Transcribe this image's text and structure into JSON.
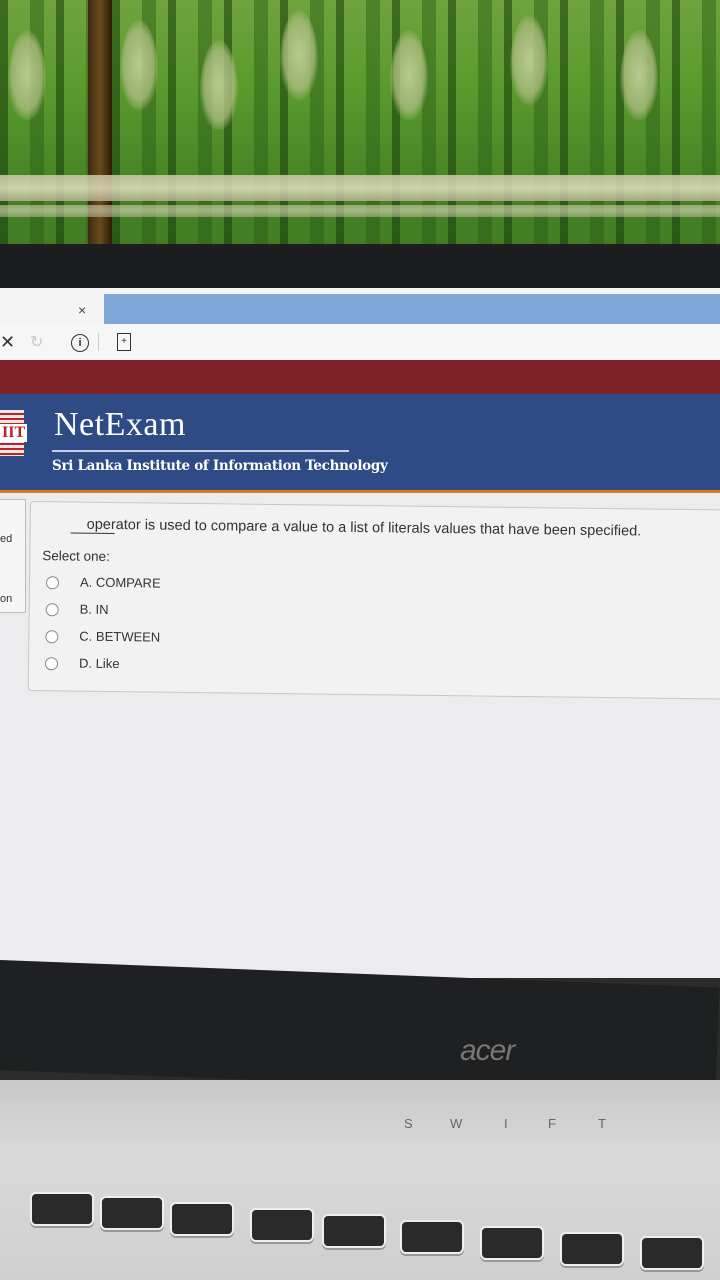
{
  "browser": {
    "tab_close_glyph": "×",
    "nav_close_glyph": "✕",
    "reload_glyph": "↻",
    "info_glyph": "i",
    "page_glyph": "+"
  },
  "header": {
    "logo_text": "IIT",
    "brand": "NetExam",
    "institute": "Sri Lanka Institute of Information Technology"
  },
  "sidebar": {
    "stub_top": "ed",
    "stub_bottom": "on"
  },
  "question": {
    "text": "operator is used to compare a value to a list of literals values that have been specified.",
    "prompt": "Select one:",
    "options": [
      {
        "label": "A. COMPARE"
      },
      {
        "label": "B. IN"
      },
      {
        "label": "C. BETWEEN"
      },
      {
        "label": "D. Like"
      }
    ]
  },
  "device": {
    "brand": "acer",
    "hinge_letters": [
      "S",
      "W",
      "I",
      "F",
      "T"
    ]
  },
  "colors": {
    "header_bg": "#2e4b86",
    "red_bar": "#7d2226",
    "accent_orange": "#d97a2a",
    "tab_blue": "#7fa8d8"
  }
}
